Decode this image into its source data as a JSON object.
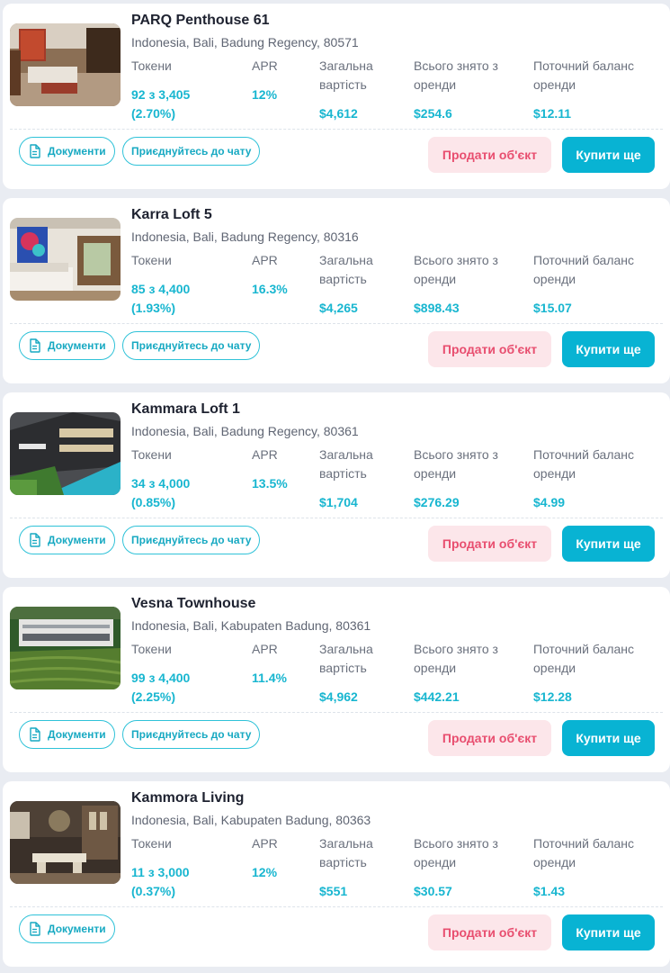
{
  "labels": {
    "tokens": "Токени",
    "apr": "APR",
    "total_1": "Загальна",
    "total_2": "вартість",
    "rent_1": "Всього знято з",
    "rent_2": "оренди",
    "balance_1": "Поточний баланс",
    "balance_2": "оренди"
  },
  "buttons": {
    "documents": "Документи",
    "join_chat": "Приєднуйтесь до чату",
    "sell": "Продати об'єкт",
    "buy": "Купити ще"
  },
  "properties": [
    {
      "title": "PARQ Penthouse 61",
      "address": "Indonesia, Bali, Badung Regency, 80571",
      "tokens": "92 з 3,405",
      "share": "(2.70%)",
      "apr": "12%",
      "total_value": "$4,612",
      "rent_withdrawn": "$254.6",
      "balance": "$12.11",
      "has_chat": true,
      "image": "living-room-photo"
    },
    {
      "title": "Karra Loft 5",
      "address": "Indonesia, Bali, Badung Regency, 80316",
      "tokens": "85 з 4,400",
      "share": "(1.93%)",
      "apr": "16.3%",
      "total_value": "$4,265",
      "rent_withdrawn": "$898.43",
      "balance": "$15.07",
      "has_chat": true,
      "image": "loft-interior-photo"
    },
    {
      "title": "Kammara Loft 1",
      "address": "Indonesia, Bali, Badung Regency, 80361",
      "tokens": "34 з 4,000",
      "share": "(0.85%)",
      "apr": "13.5%",
      "total_value": "$1,704",
      "rent_withdrawn": "$276.29",
      "balance": "$4.99",
      "has_chat": true,
      "image": "building-pool-render"
    },
    {
      "title": "Vesna Townhouse",
      "address": "Indonesia, Bali, Kabupaten Badung, 80361",
      "tokens": "99 з 4,400",
      "share": "(2.25%)",
      "apr": "11.4%",
      "total_value": "$4,962",
      "rent_withdrawn": "$442.21",
      "balance": "$12.28",
      "has_chat": true,
      "image": "aerial-townhouse-photo"
    },
    {
      "title": "Kammora Living",
      "address": "Indonesia, Bali, Kabupaten Badung, 80363",
      "tokens": "11 з 3,000",
      "share": "(0.37%)",
      "apr": "12%",
      "total_value": "$551",
      "rent_withdrawn": "$30.57",
      "balance": "$1.43",
      "has_chat": false,
      "image": "dining-interior-photo"
    }
  ],
  "colors": {
    "accent": "#08b3d3",
    "accent_text": "#18b6d0",
    "sell_bg": "#fce6ea",
    "sell_text": "#e84e6f",
    "page_bg": "#e9ecf2"
  }
}
